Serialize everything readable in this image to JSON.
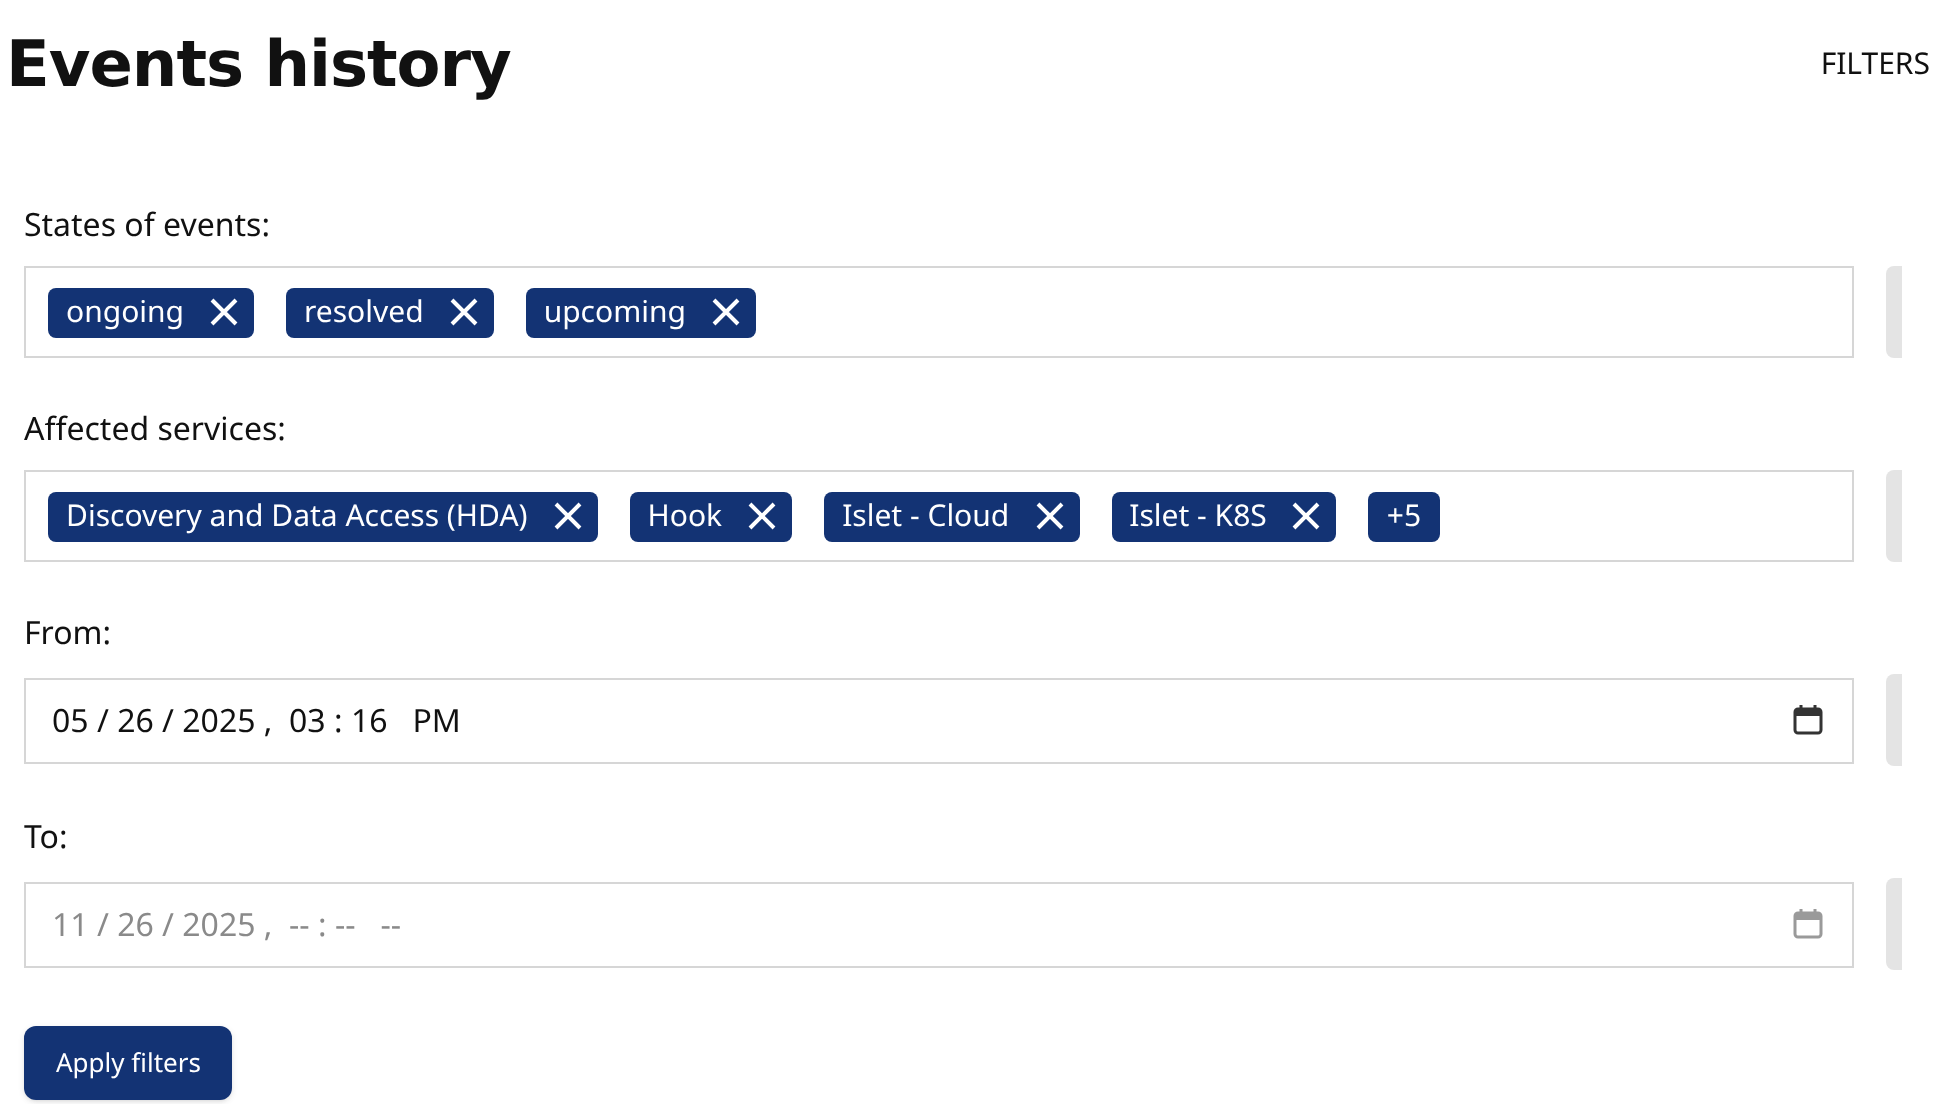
{
  "header": {
    "title": "Events history",
    "filters_link": "FILTERS"
  },
  "filters": [
    {
      "kind": "tags",
      "label": "States of events:",
      "tags": [
        {
          "kind": "tag",
          "label": "ongoing"
        },
        {
          "kind": "tag",
          "label": "resolved"
        },
        {
          "kind": "tag",
          "label": "upcoming"
        }
      ]
    },
    {
      "kind": "tags",
      "label": "Affected services:",
      "tags": [
        {
          "kind": "tag",
          "label": "Discovery and Data Access (HDA)"
        },
        {
          "kind": "tag",
          "label": "Hook"
        },
        {
          "kind": "tag",
          "label": "Islet - Cloud"
        },
        {
          "kind": "tag",
          "label": "Islet - K8S"
        },
        {
          "kind": "count",
          "label": "+5"
        }
      ]
    },
    {
      "kind": "date",
      "label": "From:",
      "value": "05 / 26 / 2025 ,  03 : 16   PM"
    },
    {
      "kind": "date",
      "label": "To:",
      "placeholder": "11 / 26 / 2025 ,  -- : --   --"
    }
  ],
  "apply_button": "Apply filters"
}
